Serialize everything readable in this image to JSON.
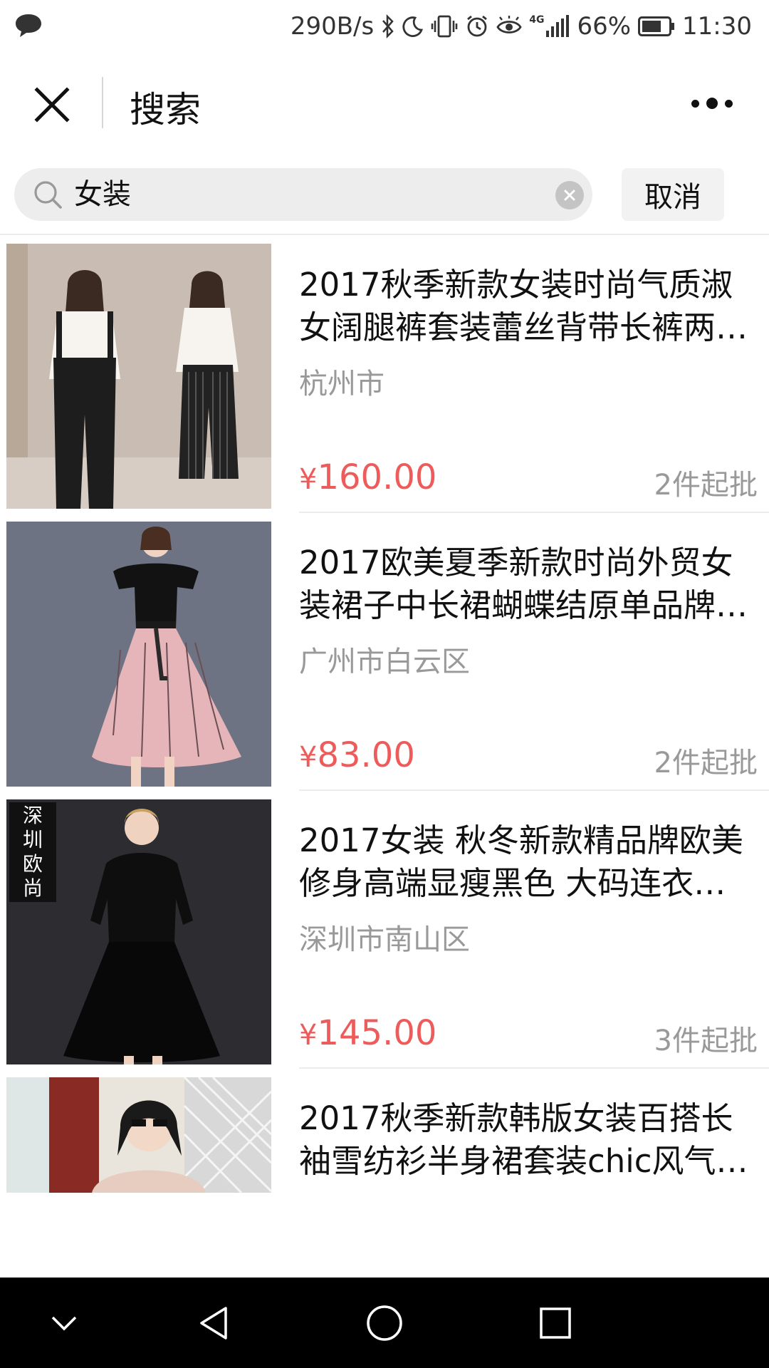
{
  "status_bar": {
    "net_speed": "290B/s",
    "network": "4G",
    "battery": "66%",
    "time": "11:30"
  },
  "header": {
    "title": "搜索"
  },
  "search": {
    "query": "女装",
    "cancel_label": "取消"
  },
  "products": [
    {
      "title": "2017秋季新款女装时尚气质淑女阔腿裤套装蕾丝背带长裤两…",
      "location": "杭州市",
      "currency": "¥",
      "price": "160.00",
      "moq": "2件起批"
    },
    {
      "title": "2017欧美夏季新款时尚外贸女装裙子中长裙蝴蝶结原单品牌…",
      "location": "广州市白云区",
      "currency": "¥",
      "price": "83.00",
      "moq": "2件起批"
    },
    {
      "title": "2017女装 秋冬新款精品牌欧美修身高端显瘦黑色 大码连衣…",
      "location": "深圳市南山区",
      "currency": "¥",
      "price": "145.00",
      "moq": "3件起批",
      "badge": "深圳欧尚"
    },
    {
      "title": "2017秋季新款韩版女装百搭长袖雪纺衫半身裙套装chic风气…"
    }
  ],
  "colors": {
    "price": "#ee5b5b",
    "secondary_text": "#999999",
    "nav_bar": "#000000"
  },
  "icons": [
    "message-icon",
    "bluetooth-icon",
    "moon-icon",
    "vibrate-icon",
    "alarm-icon",
    "eye-icon",
    "signal-icon",
    "battery-icon",
    "close-icon",
    "more-icon",
    "search-icon",
    "clear-icon",
    "nav-down-icon",
    "nav-back-icon",
    "nav-home-icon",
    "nav-recents-icon"
  ]
}
